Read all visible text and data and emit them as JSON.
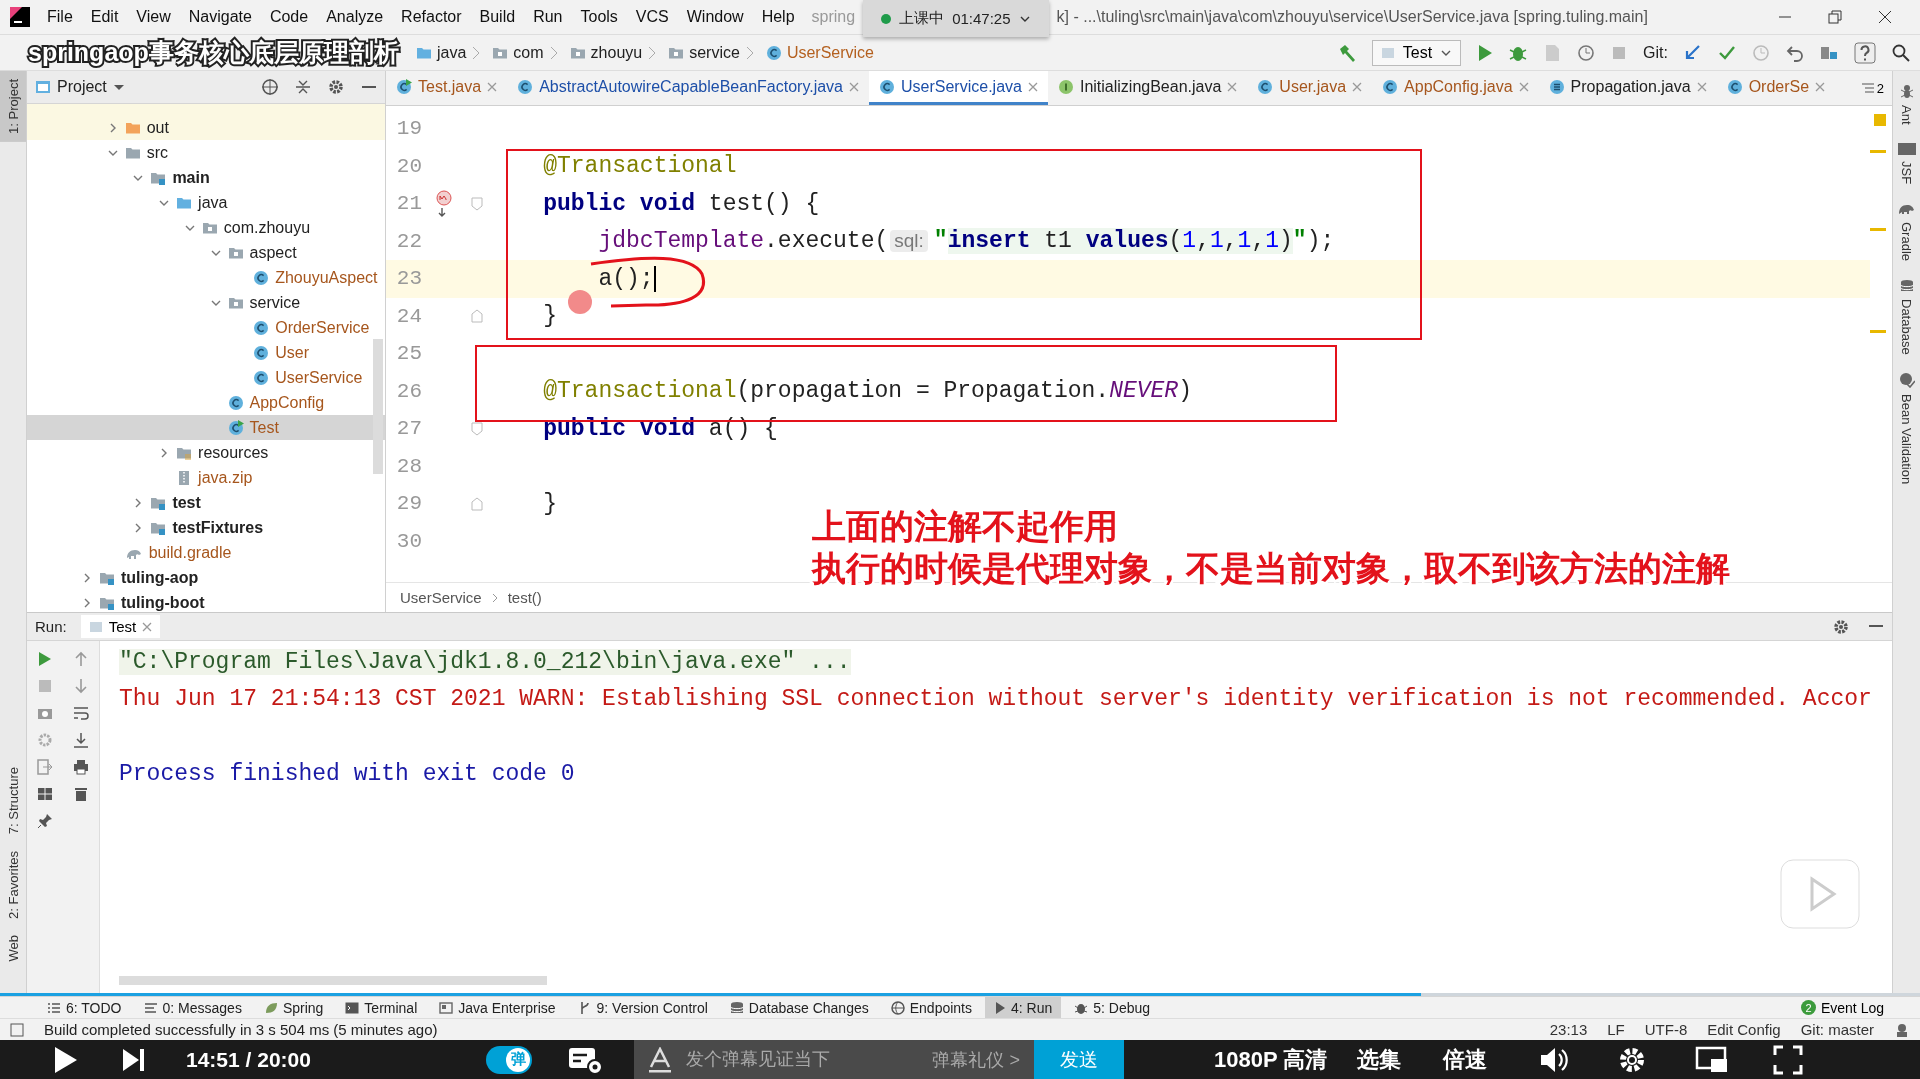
{
  "menu": [
    "File",
    "Edit",
    "View",
    "Navigate",
    "Code",
    "Analyze",
    "Refactor",
    "Build",
    "Run",
    "Tools",
    "VCS",
    "Window",
    "Help"
  ],
  "title_start": "spring",
  "class_timer": {
    "label": "上课中",
    "time": "01:47:25"
  },
  "title_path": "k] - ...\\tuling\\src\\main\\java\\com\\zhouyu\\service\\UserService.java [spring.tuling.main]",
  "video": {
    "title": "springaop事务核心底层原理剖析",
    "progress": {
      "level": 0.74
    },
    "time": "14:51 / 20:00",
    "danmaku_toggle": {
      "label": "弹",
      "on": true
    },
    "danmaku_input": {
      "placeholder": "发个弹幕见证当下"
    },
    "etiquette": "弹幕礼仪 >",
    "send": "发送",
    "quality": "1080P 高清",
    "episodes": "选集",
    "speed": "倍速"
  },
  "nav": {
    "crumbs": [
      {
        "label": "java",
        "kind": "source-folder"
      },
      {
        "label": "com",
        "kind": "package"
      },
      {
        "label": "zhouyu",
        "kind": "package"
      },
      {
        "label": "service",
        "kind": "package"
      },
      {
        "label": "UserService",
        "kind": "class"
      }
    ],
    "run_config": "Test",
    "git_label": "Git:"
  },
  "left_tabs": [
    {
      "label": "1: Project",
      "selected": true
    },
    {
      "label": "7: Structure",
      "selected": false
    },
    {
      "label": "2: Favorites",
      "selected": false
    },
    {
      "label": "Web",
      "selected": false
    }
  ],
  "right_tabs": [
    {
      "label": "Ant",
      "kind": "ant"
    },
    {
      "label": "JSF",
      "kind": "jsf"
    },
    {
      "label": "Gradle",
      "kind": "gradle"
    },
    {
      "label": "Database",
      "kind": "database"
    },
    {
      "label": "Bean Validation",
      "kind": "bean"
    }
  ],
  "project_panel": {
    "title": "Project",
    "partial_module_children": [
      {
        "label": "out",
        "kind": "excluded-folder",
        "expanded": false,
        "unversioned": false,
        "selected": false
      },
      {
        "label": "src",
        "kind": "folder",
        "expanded": true,
        "unversioned": false,
        "selected": false,
        "children": [
          {
            "label": "main",
            "kind": "source-root",
            "expanded": true,
            "unversioned": false,
            "selected": false,
            "children": [
              {
                "label": "java",
                "kind": "source-folder",
                "expanded": true,
                "unversioned": false,
                "selected": false,
                "children": [
                  {
                    "label": "com.zhouyu",
                    "kind": "package",
                    "expanded": true,
                    "unversioned": false,
                    "selected": false,
                    "children": [
                      {
                        "label": "aspect",
                        "kind": "package",
                        "expanded": true,
                        "unversioned": false,
                        "selected": false,
                        "children": [
                          {
                            "label": "ZhouyuAspect",
                            "kind": "class",
                            "unversioned": true,
                            "selected": false
                          }
                        ]
                      },
                      {
                        "label": "service",
                        "kind": "package",
                        "expanded": true,
                        "unversioned": false,
                        "selected": false,
                        "children": [
                          {
                            "label": "OrderService",
                            "kind": "class",
                            "unversioned": true,
                            "selected": false
                          },
                          {
                            "label": "User",
                            "kind": "class",
                            "unversioned": true,
                            "selected": false
                          },
                          {
                            "label": "UserService",
                            "kind": "class",
                            "unversioned": true,
                            "selected": false
                          }
                        ]
                      },
                      {
                        "label": "AppConfig",
                        "kind": "class",
                        "unversioned": true,
                        "selected": false
                      },
                      {
                        "label": "Test",
                        "kind": "run-class",
                        "unversioned": true,
                        "selected": true
                      }
                    ]
                  }
                ]
              },
              {
                "label": "resources",
                "kind": "resources-folder",
                "expanded": false,
                "unversioned": false,
                "selected": false
              },
              {
                "label": "java.zip",
                "kind": "archive",
                "unversioned": true,
                "selected": false
              }
            ]
          },
          {
            "label": "test",
            "kind": "source-root",
            "expanded": false,
            "unversioned": false,
            "selected": false
          },
          {
            "label": "testFixtures",
            "kind": "source-root",
            "expanded": false,
            "unversioned": false,
            "selected": false
          }
        ]
      },
      {
        "label": "build.gradle",
        "kind": "gradle-file",
        "unversioned": true,
        "selected": false
      }
    ],
    "modules": [
      {
        "label": "tuling-aop",
        "kind": "module",
        "expanded": false,
        "unversioned": false,
        "selected": false
      },
      {
        "label": "tuling-boot",
        "kind": "module",
        "expanded": false,
        "unversioned": false,
        "selected": false
      }
    ]
  },
  "editor": {
    "tabs": [
      {
        "label": "Test.java",
        "kind": "run-class",
        "color": "#a6561d",
        "selected": false
      },
      {
        "label": "AbstractAutowireCapableBeanFactory.java",
        "kind": "class",
        "color": "#1d4fa8",
        "selected": false
      },
      {
        "label": "UserService.java",
        "kind": "class",
        "color": "#1d4fa8",
        "selected": true
      },
      {
        "label": "InitializingBean.java",
        "kind": "interface",
        "color": "#222222",
        "selected": false
      },
      {
        "label": "User.java",
        "kind": "class",
        "color": "#a6561d",
        "selected": false
      },
      {
        "label": "AppConfig.java",
        "kind": "class",
        "color": "#a6561d",
        "selected": false
      },
      {
        "label": "Propagation.java",
        "kind": "enum",
        "color": "#222222",
        "selected": false
      },
      {
        "label": "OrderSe",
        "kind": "class",
        "color": "#a6561d",
        "selected": false
      }
    ],
    "tab_overflow": "2",
    "lines": [
      {
        "number": "19",
        "kind": "plain",
        "current": false
      },
      {
        "number": "20",
        "kind": "plain",
        "current": false,
        "tokens": [
          {
            "text": "    @Transactional",
            "kind": "annotation"
          }
        ]
      },
      {
        "number": "21",
        "kind": "override-method-start",
        "current": false,
        "tokens": [
          {
            "text": "    public void",
            "kind": "keyword"
          },
          {
            "text": " test() {",
            "kind": "plain"
          }
        ]
      },
      {
        "number": "22",
        "kind": "plain",
        "current": false,
        "tokens": [
          {
            "text": "        jdbcTemplate",
            "kind": "field"
          },
          {
            "text": ".execute(",
            "kind": "plain"
          },
          {
            "text": "sql:",
            "kind": "hint"
          },
          {
            "text": "\"",
            "kind": "quote"
          },
          {
            "text": "insert",
            "kind": "sql-keyword"
          },
          {
            "text": " t1 ",
            "kind": "sql"
          },
          {
            "text": "values",
            "kind": "sql-keyword"
          },
          {
            "text": "(",
            "kind": "sql"
          },
          {
            "text": "1",
            "kind": "number"
          },
          {
            "text": ",",
            "kind": "sql"
          },
          {
            "text": "1",
            "kind": "number"
          },
          {
            "text": ",",
            "kind": "sql"
          },
          {
            "text": "1",
            "kind": "number"
          },
          {
            "text": ",",
            "kind": "sql"
          },
          {
            "text": "1",
            "kind": "number"
          },
          {
            "text": ")",
            "kind": "sql"
          },
          {
            "text": "\"",
            "kind": "quote"
          },
          {
            "text": ");",
            "kind": "plain"
          }
        ]
      },
      {
        "number": "23",
        "kind": "plain",
        "current": true,
        "tokens": [
          {
            "text": "        a();",
            "kind": "plain"
          }
        ]
      },
      {
        "number": "24",
        "kind": "block-end",
        "current": false,
        "tokens": [
          {
            "text": "    }",
            "kind": "plain"
          }
        ]
      },
      {
        "number": "25",
        "kind": "plain",
        "current": false
      },
      {
        "number": "26",
        "kind": "plain",
        "current": false,
        "tokens": [
          {
            "text": "    @Transactional",
            "kind": "annotation"
          },
          {
            "text": "(propagation = Propagation.",
            "kind": "plain"
          },
          {
            "text": "NEVER",
            "kind": "constant"
          },
          {
            "text": ")",
            "kind": "plain"
          }
        ]
      },
      {
        "number": "27",
        "kind": "method-start",
        "current": false,
        "tokens": [
          {
            "text": "    public void",
            "kind": "keyword"
          },
          {
            "text": " a() {",
            "kind": "plain"
          }
        ]
      },
      {
        "number": "28",
        "kind": "plain",
        "current": false
      },
      {
        "number": "29",
        "kind": "block-end",
        "current": false,
        "tokens": [
          {
            "text": "    }",
            "kind": "plain"
          }
        ]
      },
      {
        "number": "30",
        "kind": "plain",
        "current": false
      }
    ],
    "breadcrumb": [
      "UserService",
      "test()"
    ],
    "annotation": [
      "上面的注解不起作用",
      "执行的时候是代理对象，不是当前对象，取不到该方法的注解"
    ]
  },
  "run_panel": {
    "label": "Run:",
    "tab": "Test",
    "console": [
      {
        "kind": "command",
        "text": "\"C:\\Program Files\\Java\\jdk1.8.0_212\\bin\\java.exe\" ..."
      },
      {
        "kind": "error",
        "text": "Thu Jun 17 21:54:13 CST 2021 WARN: Establishing SSL connection without server's identity verification is not recommended. Accor"
      },
      {
        "kind": "blank"
      },
      {
        "kind": "normal",
        "text": "Process finished with exit code 0"
      }
    ]
  },
  "tool_windows": [
    {
      "label": "6: TODO",
      "kind": "list",
      "selected": false
    },
    {
      "label": "0: Messages",
      "kind": "messages",
      "selected": false
    },
    {
      "label": "Spring",
      "kind": "leaf",
      "selected": false
    },
    {
      "label": "Terminal",
      "kind": "terminal",
      "selected": false
    },
    {
      "label": "Java Enterprise",
      "kind": "enterprise",
      "selected": false
    },
    {
      "label": "9: Version Control",
      "kind": "vcs",
      "selected": false
    },
    {
      "label": "Database Changes",
      "kind": "database",
      "selected": false
    },
    {
      "label": "Endpoints",
      "kind": "globe",
      "selected": false
    },
    {
      "label": "4: Run",
      "kind": "run",
      "selected": true
    },
    {
      "label": "5: Debug",
      "kind": "debug",
      "selected": false
    }
  ],
  "event_log": {
    "count": "2",
    "label": "Event Log"
  },
  "status": {
    "message": "Build completed successfully in 3 s 504 ms (5 minutes ago)",
    "position": "23:13",
    "line_separator": "LF",
    "encoding": "UTF-8",
    "edit_config": "Edit Config",
    "git": "Git: master"
  }
}
